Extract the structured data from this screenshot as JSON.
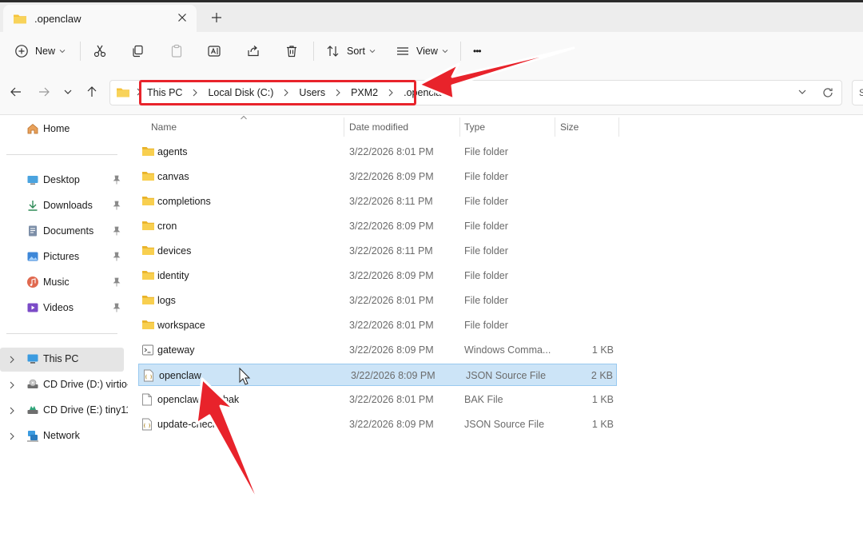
{
  "window": {
    "tab_title": ".openclaw"
  },
  "toolbar": {
    "new_label": "New",
    "sort_label": "Sort",
    "view_label": "View",
    "more_label": "•••"
  },
  "address": {
    "crumbs": [
      "This PC",
      "Local Disk (C:)",
      "Users",
      "PXM2",
      ".openclaw"
    ],
    "search_stub": "S"
  },
  "sidebar": {
    "home": "Home",
    "quick": [
      "Desktop",
      "Downloads",
      "Documents",
      "Pictures",
      "Music",
      "Videos"
    ],
    "this_pc": "This PC",
    "drive_d": "CD Drive (D:) virtio-",
    "drive_e": "CD Drive (E:) tiny11",
    "network": "Network"
  },
  "columns": {
    "name": "Name",
    "date": "Date modified",
    "type": "Type",
    "size": "Size"
  },
  "files": [
    {
      "name": "agents",
      "date": "3/22/2026 8:01 PM",
      "type": "File folder",
      "size": "",
      "icon": "folder-icon"
    },
    {
      "name": "canvas",
      "date": "3/22/2026 8:09 PM",
      "type": "File folder",
      "size": "",
      "icon": "folder-icon"
    },
    {
      "name": "completions",
      "date": "3/22/2026 8:11 PM",
      "type": "File folder",
      "size": "",
      "icon": "folder-icon"
    },
    {
      "name": "cron",
      "date": "3/22/2026 8:09 PM",
      "type": "File folder",
      "size": "",
      "icon": "folder-icon"
    },
    {
      "name": "devices",
      "date": "3/22/2026 8:11 PM",
      "type": "File folder",
      "size": "",
      "icon": "folder-icon"
    },
    {
      "name": "identity",
      "date": "3/22/2026 8:09 PM",
      "type": "File folder",
      "size": "",
      "icon": "folder-icon"
    },
    {
      "name": "logs",
      "date": "3/22/2026 8:01 PM",
      "type": "File folder",
      "size": "",
      "icon": "folder-icon"
    },
    {
      "name": "workspace",
      "date": "3/22/2026 8:01 PM",
      "type": "File folder",
      "size": "",
      "icon": "folder-icon"
    },
    {
      "name": "gateway",
      "date": "3/22/2026 8:09 PM",
      "type": "Windows Comma...",
      "size": "1 KB",
      "icon": "command-script-icon"
    },
    {
      "name": "openclaw",
      "date": "3/22/2026 8:09 PM",
      "type": "JSON Source File",
      "size": "2 KB",
      "icon": "json-file-icon",
      "selected": true
    },
    {
      "name": "openclaw.json.bak",
      "date": "3/22/2026 8:01 PM",
      "type": "BAK File",
      "size": "1 KB",
      "icon": "blank-file-icon"
    },
    {
      "name": "update-check",
      "date": "3/22/2026 8:09 PM",
      "type": "JSON Source File",
      "size": "1 KB",
      "icon": "json-file-icon"
    }
  ],
  "colors": {
    "accent_red": "#e8232b",
    "selection": "#cce4f7",
    "folder_yellow": "#f5c33b"
  }
}
